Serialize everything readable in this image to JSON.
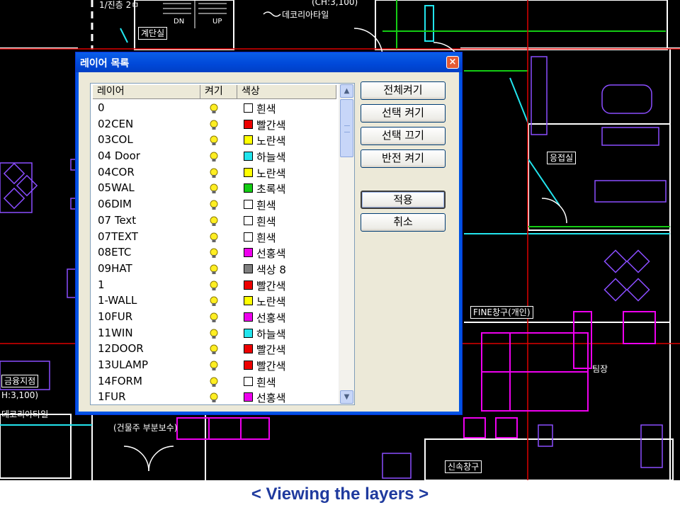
{
  "dialog": {
    "title": "레이어 목록",
    "close_glyph": "×"
  },
  "columns": {
    "layer": "레이어",
    "on": "켜기",
    "color": "색상"
  },
  "layers": [
    {
      "name": "0",
      "color_name": "흰색",
      "hex": "#ffffff"
    },
    {
      "name": "02CEN",
      "color_name": "빨간색",
      "hex": "#ee0000"
    },
    {
      "name": "03COL",
      "color_name": "노란색",
      "hex": "#ffff00"
    },
    {
      "name": "04 Door",
      "color_name": "하늘색",
      "hex": "#22e5ee"
    },
    {
      "name": "04COR",
      "color_name": "노란색",
      "hex": "#ffff00"
    },
    {
      "name": "05WAL",
      "color_name": "초록색",
      "hex": "#14cc14"
    },
    {
      "name": "06DIM",
      "color_name": "흰색",
      "hex": "#ffffff"
    },
    {
      "name": "07 Text",
      "color_name": "흰색",
      "hex": "#ffffff"
    },
    {
      "name": "07TEXT",
      "color_name": "흰색",
      "hex": "#ffffff"
    },
    {
      "name": "08ETC",
      "color_name": "선홍색",
      "hex": "#ee00ee"
    },
    {
      "name": "09HAT",
      "color_name": "색상 8",
      "hex": "#7f7f7f"
    },
    {
      "name": "1",
      "color_name": "빨간색",
      "hex": "#ee0000"
    },
    {
      "name": "1-WALL",
      "color_name": "노란색",
      "hex": "#ffff00"
    },
    {
      "name": "10FUR",
      "color_name": "선홍색",
      "hex": "#ee00ee"
    },
    {
      "name": "11WIN",
      "color_name": "하늘색",
      "hex": "#22e5ee"
    },
    {
      "name": "12DOOR",
      "color_name": "빨간색",
      "hex": "#ee0000"
    },
    {
      "name": "13ULAMP",
      "color_name": "빨간색",
      "hex": "#ee0000"
    },
    {
      "name": "14FORM",
      "color_name": "흰색",
      "hex": "#ffffff"
    },
    {
      "name": "1FUR",
      "color_name": "선홍색",
      "hex": "#ee00ee"
    }
  ],
  "buttons": {
    "all_on": "전체켜기",
    "select_on": "선택 켜기",
    "select_off": "선택 끄기",
    "invert_on": "반전 켜기",
    "apply": "적용",
    "cancel": "취소"
  },
  "scrollbar": {
    "up_glyph": "▲",
    "down_glyph": "▼"
  },
  "cad": {
    "label_stairs": "계단실",
    "label_dn": "DN",
    "label_up": "UP",
    "label_deco_top": "데코리아타일",
    "label_scale_top": "(CH:3,100)",
    "label_reception": "응접실",
    "label_fine_window": "FINE창구(개인)",
    "label_finance": "금융지점",
    "label_scale_left": "H:3,100)",
    "label_deco_left": "데코리아타일",
    "label_owner_repair": "(건물주 부분보수)",
    "label_new_window": "신속창구",
    "label_team": "팀장",
    "label_floor": "1/진층 2ㅁ"
  },
  "caption": "<  Viewing the layers  >",
  "colors": {
    "title_bar": "#0054e3",
    "caption": "#1f3a9e",
    "bulb": "#ffee22"
  }
}
